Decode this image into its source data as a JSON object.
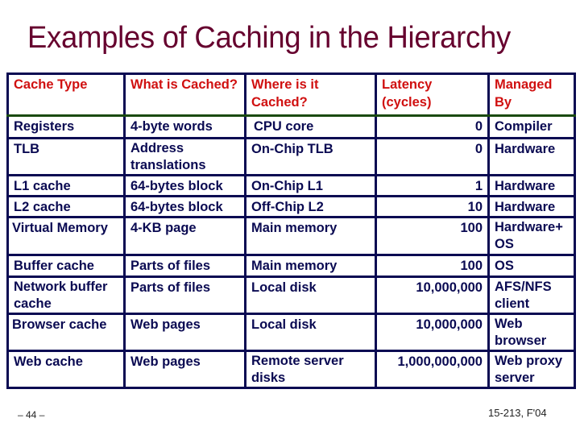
{
  "slide": {
    "title": "Examples of Caching in the Hierarchy",
    "page_number": "– 44 –",
    "course_label": "15-213, F'04"
  },
  "table": {
    "headers": [
      "Cache Type",
      "What is Cached?",
      "Where is it Cached?",
      "Latency (cycles)",
      "Managed By"
    ],
    "rows": [
      {
        "cache_type": "Registers",
        "what": "4-byte words",
        "where": "CPU core",
        "latency": "0",
        "managed_by": "Compiler"
      },
      {
        "cache_type": "TLB",
        "what": "Address translations",
        "where": "On-Chip TLB",
        "latency": "0",
        "managed_by": "Hardware"
      },
      {
        "cache_type": "L1 cache",
        "what": "64-bytes block",
        "where": "On-Chip L1",
        "latency": "1",
        "managed_by": "Hardware"
      },
      {
        "cache_type": "L2 cache",
        "what": "64-bytes block",
        "where": "Off-Chip L2",
        "latency": "10",
        "managed_by": "Hardware"
      },
      {
        "cache_type": "Virtual Memory",
        "what": "4-KB page",
        "where": "Main memory",
        "latency": "100",
        "managed_by": "Hardware+ OS"
      },
      {
        "cache_type": "Buffer cache",
        "what": "Parts of files",
        "where": "Main memory",
        "latency": "100",
        "managed_by": "OS"
      },
      {
        "cache_type": "Network buffer cache",
        "what": "Parts of files",
        "where": "Local disk",
        "latency": "10,000,000",
        "managed_by": "AFS/NFS client"
      },
      {
        "cache_type": "Browser cache",
        "what": "Web pages",
        "where": "Local disk",
        "latency": "10,000,000",
        "managed_by": "Web browser"
      },
      {
        "cache_type": "Web cache",
        "what": "Web pages",
        "where": "Remote server disks",
        "latency": "1,000,000,000",
        "managed_by": "Web proxy server"
      }
    ]
  },
  "colors": {
    "title": "#66002e",
    "header_text": "#d01010",
    "body_text": "#0a0a52",
    "border": "#0a0a52",
    "header_rule": "#1a4a10"
  }
}
